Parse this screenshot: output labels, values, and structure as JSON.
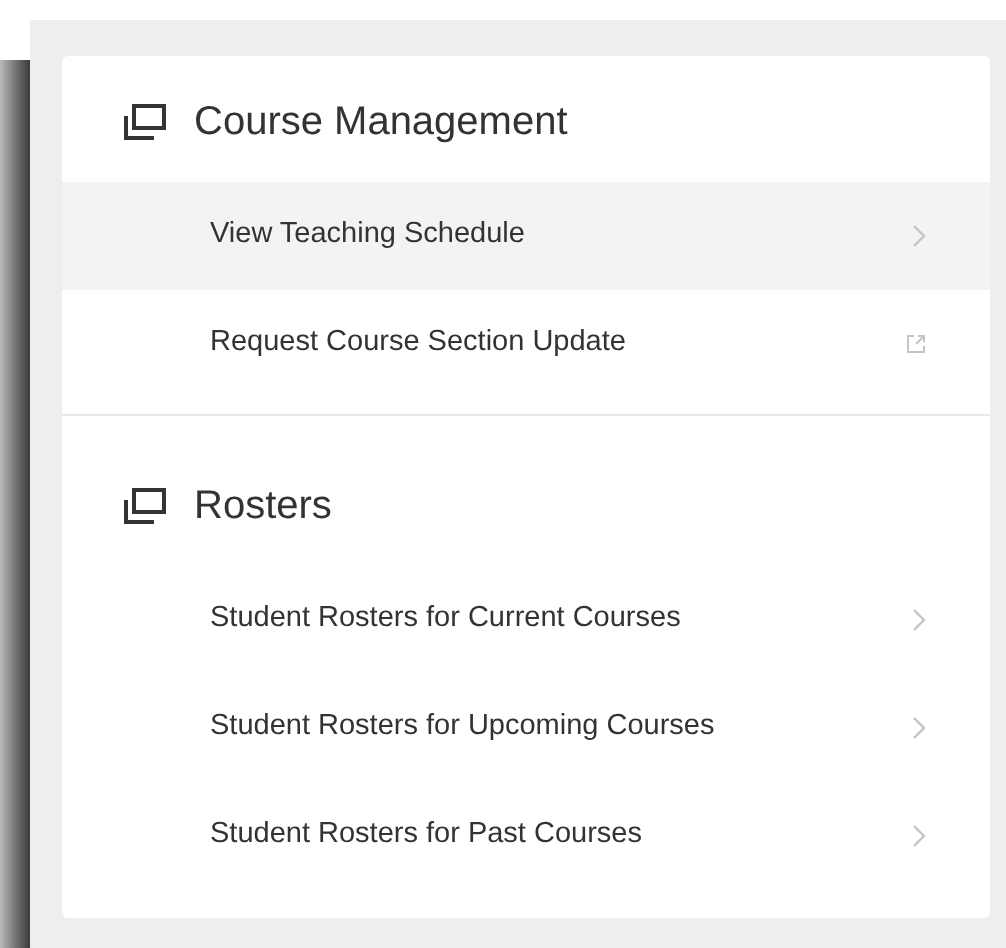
{
  "sections": [
    {
      "title": "Course Management",
      "items": [
        {
          "label": "View Teaching Schedule",
          "kind": "chevron",
          "selected": true
        },
        {
          "label": "Request Course Section Update",
          "kind": "external",
          "selected": false
        }
      ]
    },
    {
      "title": "Rosters",
      "items": [
        {
          "label": "Student Rosters for Current Courses",
          "kind": "chevron",
          "selected": false
        },
        {
          "label": "Student Rosters for Upcoming Courses",
          "kind": "chevron",
          "selected": false
        },
        {
          "label": "Student Rosters for Past Courses",
          "kind": "chevron",
          "selected": false
        }
      ]
    }
  ]
}
